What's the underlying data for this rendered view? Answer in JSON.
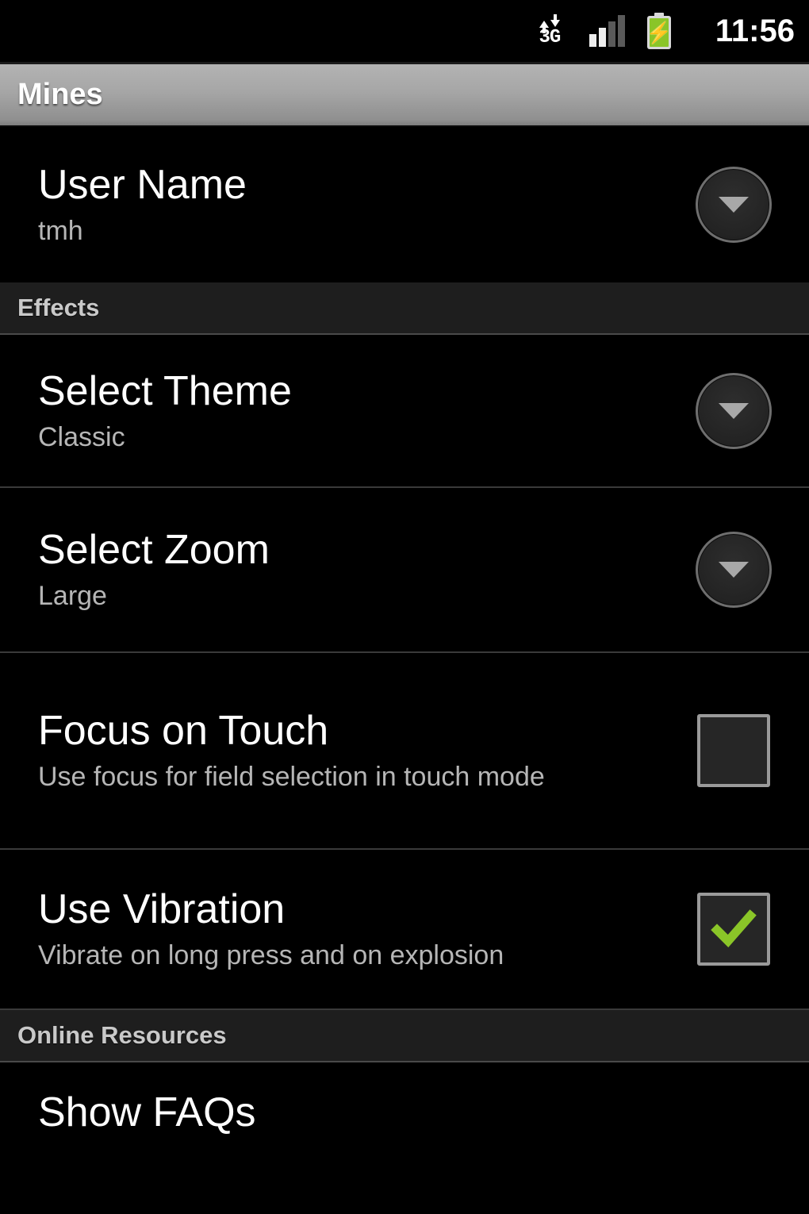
{
  "status_bar": {
    "network_icon": "3g-data-icon",
    "network_label": "3G",
    "signal_icon": "signal-bars-icon",
    "signal_bars_total": 4,
    "signal_bars_active": 2,
    "battery_icon": "battery-charging-icon",
    "battery_bolt": "⚡",
    "battery_color": "#8ac528",
    "clock": "11:56"
  },
  "title_bar": {
    "title": "Mines"
  },
  "sections": [
    {
      "header": null,
      "rows": [
        {
          "name": "user-name",
          "title": "User Name",
          "summary": "tmh",
          "widget": "dropdown"
        }
      ]
    },
    {
      "header": "Effects",
      "rows": [
        {
          "name": "select-theme",
          "title": "Select Theme",
          "summary": "Classic",
          "widget": "dropdown"
        },
        {
          "name": "select-zoom",
          "title": "Select Zoom",
          "summary": "Large",
          "widget": "dropdown"
        },
        {
          "name": "focus-on-touch",
          "title": "Focus on Touch",
          "summary": "Use focus for field selection in touch mode",
          "widget": "checkbox",
          "checked": false
        },
        {
          "name": "use-vibration",
          "title": "Use Vibration",
          "summary": "Vibrate on long press and on explosion",
          "widget": "checkbox",
          "checked": true
        }
      ]
    },
    {
      "header": "Online Resources",
      "rows": [
        {
          "name": "show-faqs",
          "title": "Show FAQs",
          "summary": null,
          "widget": "none"
        }
      ]
    }
  ],
  "colors": {
    "background": "#000000",
    "section_header_bg": "#1e1e1e",
    "section_header_text": "#c9c9c9",
    "title_text": "#ffffff",
    "summary_text": "#b6b6b6",
    "checkmark_green": "#8ac528",
    "divider": "#3a3a3a"
  }
}
